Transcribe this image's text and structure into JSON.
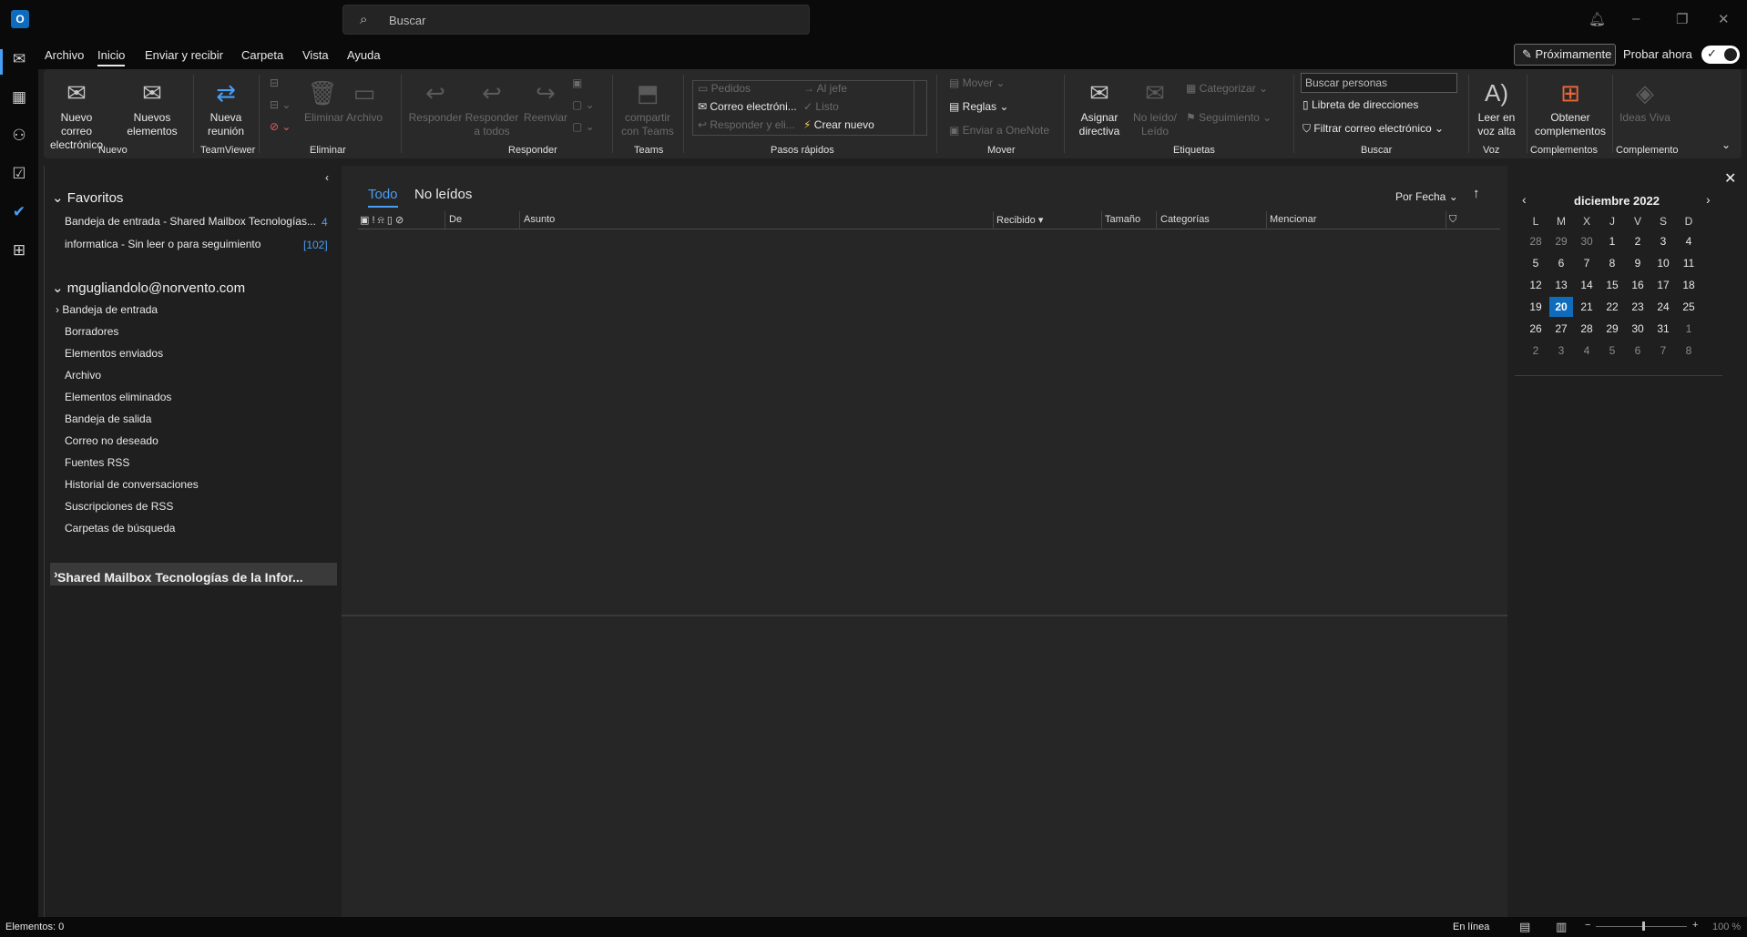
{
  "app": {
    "icon_letter": "O"
  },
  "search": {
    "placeholder": "Buscar"
  },
  "menu": {
    "tabs": [
      "Archivo",
      "Inicio",
      "Enviar y recibir",
      "Carpeta",
      "Vista",
      "Ayuda"
    ],
    "proximamente": "Próximamente",
    "probar": "Probar ahora"
  },
  "ribbon": {
    "nuevo_correo": "Nuevo correo electrónico",
    "nuevos_elementos": "Nuevos elementos",
    "nueva_reunion": "Nueva reunión",
    "eliminar": "Eliminar",
    "archivo": "Archivo",
    "responder": "Responder",
    "responder_todos": "Responder a todos",
    "reenviar": "Reenviar",
    "compartir_teams": "compartir con Teams",
    "qs_pedidos": "Pedidos",
    "qs_correo": "Correo electróni...",
    "qs_responder": "Responder y eli...",
    "qs_aljefe": "Al jefe",
    "qs_listo": "Listo",
    "qs_crear": "Crear nuevo",
    "mover": "Mover",
    "reglas": "Reglas",
    "onenote": "Enviar a OneNote",
    "asignar_directiva": "Asignar directiva",
    "noleido_leido": "No leído/ Leído",
    "categorizar": "Categorizar",
    "seguimiento": "Seguimiento",
    "buscar_personas": "Buscar personas",
    "libreta": "Libreta de direcciones",
    "filtrar": "Filtrar correo electrónico",
    "leer_voz": "Leer en voz alta",
    "obtener_complementos": "Obtener complementos",
    "ideas_viva": "Ideas Viva",
    "groups": {
      "nuevo": "Nuevo",
      "teamviewer": "TeamViewer",
      "eliminar": "Eliminar",
      "responder": "Responder",
      "teams": "Teams",
      "pasos": "Pasos rápidos",
      "mover": "Mover",
      "etiquetas": "Etiquetas",
      "buscar": "Buscar",
      "voz": "Voz",
      "complementos": "Complementos",
      "complemento": "Complemento"
    }
  },
  "folders": {
    "favoritos": "Favoritos",
    "fav_items": [
      {
        "label": "Bandeja de entrada - Shared Mailbox Tecnologías...",
        "count": "4"
      },
      {
        "label": "informatica - Sin leer o para seguimiento",
        "count": "[102]"
      }
    ],
    "account": "mgugliandolo@norvento.com",
    "account_items": [
      "Bandeja de entrada",
      "Borradores",
      "Elementos enviados",
      "Archivo",
      "Elementos eliminados",
      "Bandeja de salida",
      "Correo no deseado",
      "Fuentes RSS",
      "Historial de conversaciones",
      "Suscripciones de RSS",
      "Carpetas de búsqueda"
    ],
    "shared": "Shared Mailbox Tecnologías de la Infor..."
  },
  "messages": {
    "tab_all": "Todo",
    "tab_unread": "No leídos",
    "sort": "Por Fecha",
    "columns": {
      "de": "De",
      "asunto": "Asunto",
      "recibido": "Recibido",
      "tamano": "Tamaño",
      "categorias": "Categorías",
      "mencionar": "Mencionar"
    }
  },
  "calendar": {
    "month": "diciembre 2022",
    "dow": [
      "L",
      "M",
      "X",
      "J",
      "V",
      "S",
      "D"
    ],
    "weeks": [
      [
        "28",
        "29",
        "30",
        "1",
        "2",
        "3",
        "4"
      ],
      [
        "5",
        "6",
        "7",
        "8",
        "9",
        "10",
        "11"
      ],
      [
        "12",
        "13",
        "14",
        "15",
        "16",
        "17",
        "18"
      ],
      [
        "19",
        "20",
        "21",
        "22",
        "23",
        "24",
        "25"
      ],
      [
        "26",
        "27",
        "28",
        "29",
        "30",
        "31",
        "1"
      ],
      [
        "2",
        "3",
        "4",
        "5",
        "6",
        "7",
        "8"
      ]
    ],
    "today": "20"
  },
  "status": {
    "items": "Elementos: 0",
    "online": "En línea",
    "zoom": "100 %"
  },
  "colors": {
    "accent": "#479ef5",
    "today_bg": "#0f6cbd",
    "background": "#1f1f1f"
  }
}
